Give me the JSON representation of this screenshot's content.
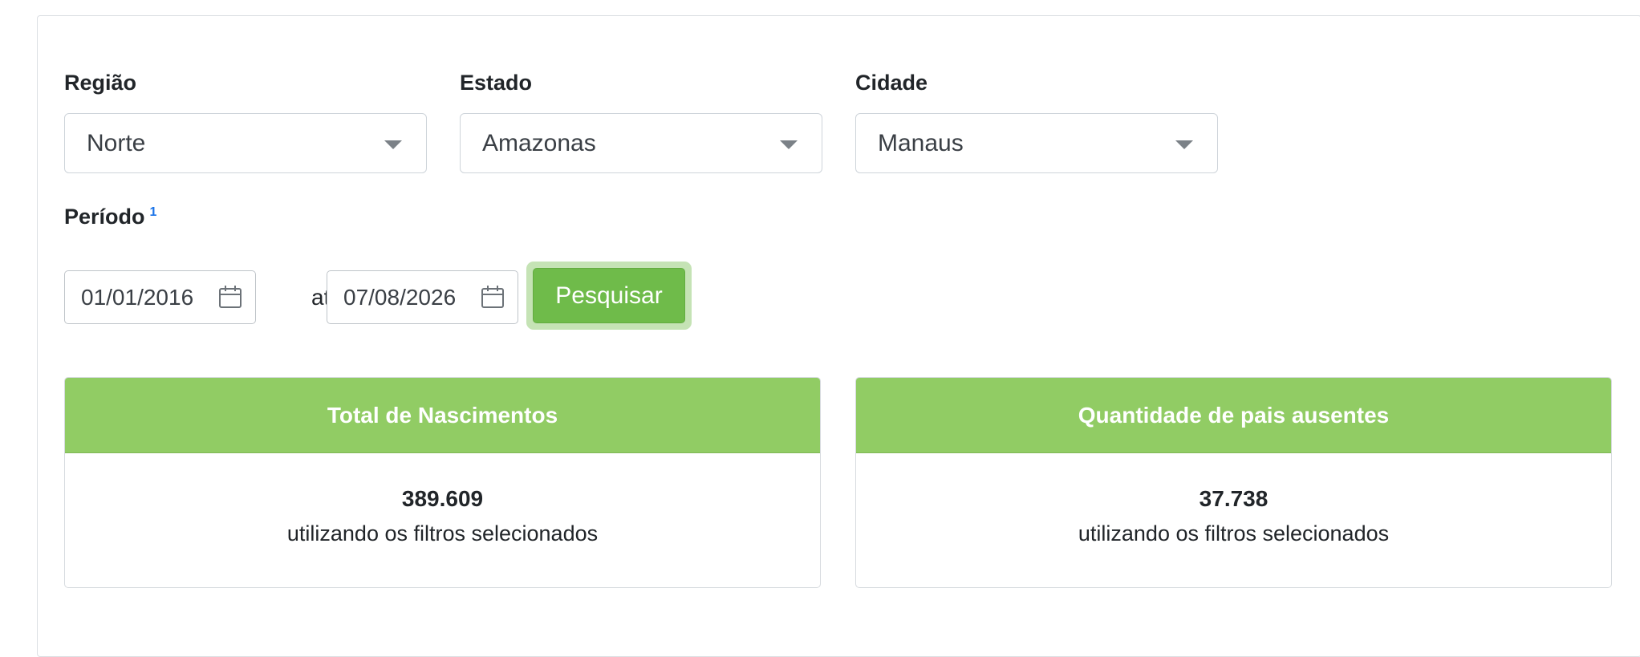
{
  "filters": {
    "regiao": {
      "label": "Região",
      "value": "Norte"
    },
    "estado": {
      "label": "Estado",
      "value": "Amazonas"
    },
    "cidade": {
      "label": "Cidade",
      "value": "Manaus"
    }
  },
  "periodo": {
    "label": "Período",
    "footnote": "1",
    "start": "01/01/2016",
    "separator": "até",
    "end": "07/08/2026",
    "search_label": "Pesquisar"
  },
  "cards": [
    {
      "title": "Total de Nascimentos",
      "value": "389.609",
      "caption": "utilizando os filtros selecionados"
    },
    {
      "title": "Quantidade de pais ausentes",
      "value": "37.738",
      "caption": "utilizando os filtros selecionados"
    }
  ],
  "colors": {
    "accent_green": "#91cc64",
    "button_green": "#6fbb4a"
  }
}
